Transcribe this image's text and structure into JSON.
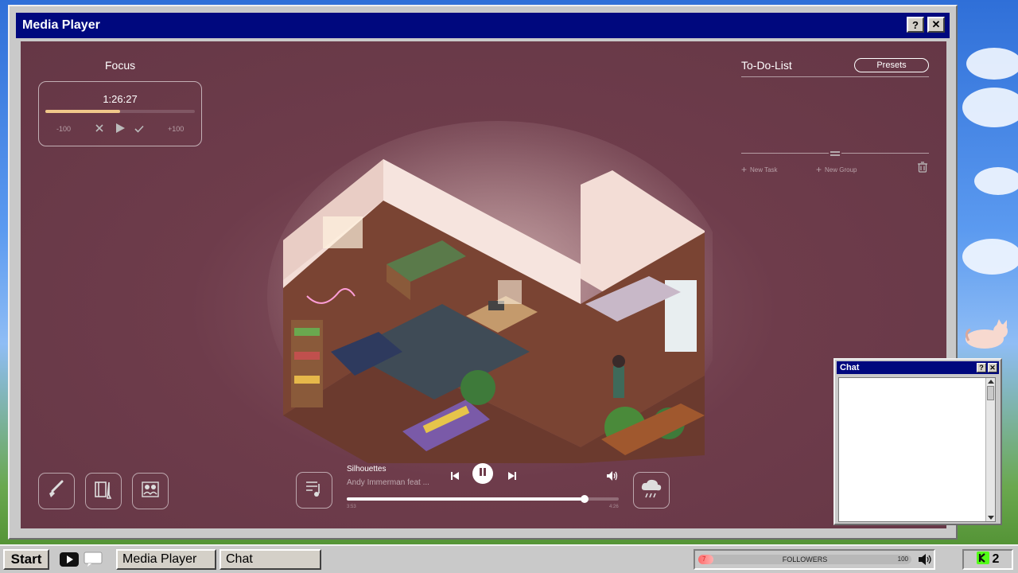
{
  "window": {
    "title": "Media Player",
    "help_label": "?",
    "close_label": "✕"
  },
  "focus": {
    "title": "Focus",
    "time": "1:26:27",
    "progress_fraction": 0.5,
    "minus_label": "-100",
    "plus_label": "+100"
  },
  "todo": {
    "title": "To-Do-List",
    "presets_label": "Presets",
    "new_task_label": "New Task",
    "new_group_label": "New Group"
  },
  "player": {
    "song_title": "Silhouettes",
    "artist": "Andy Immerman feat ...",
    "elapsed": "3:53",
    "total": "4:26",
    "progress_fraction": 0.874
  },
  "chat": {
    "title": "Chat",
    "help_label": "?",
    "close_label": "✕"
  },
  "taskbar": {
    "start_label": "Start",
    "tasks": [
      "Media Player",
      "Chat"
    ],
    "followers_label": "FOLLOWERS",
    "followers_current": "7",
    "followers_goal": "100",
    "followers_fraction": 0.07,
    "tray_count": "2"
  },
  "colors": {
    "title_bar": "#00087e",
    "content_bg": "#6e3c4b",
    "accent": "#f0c88a"
  }
}
